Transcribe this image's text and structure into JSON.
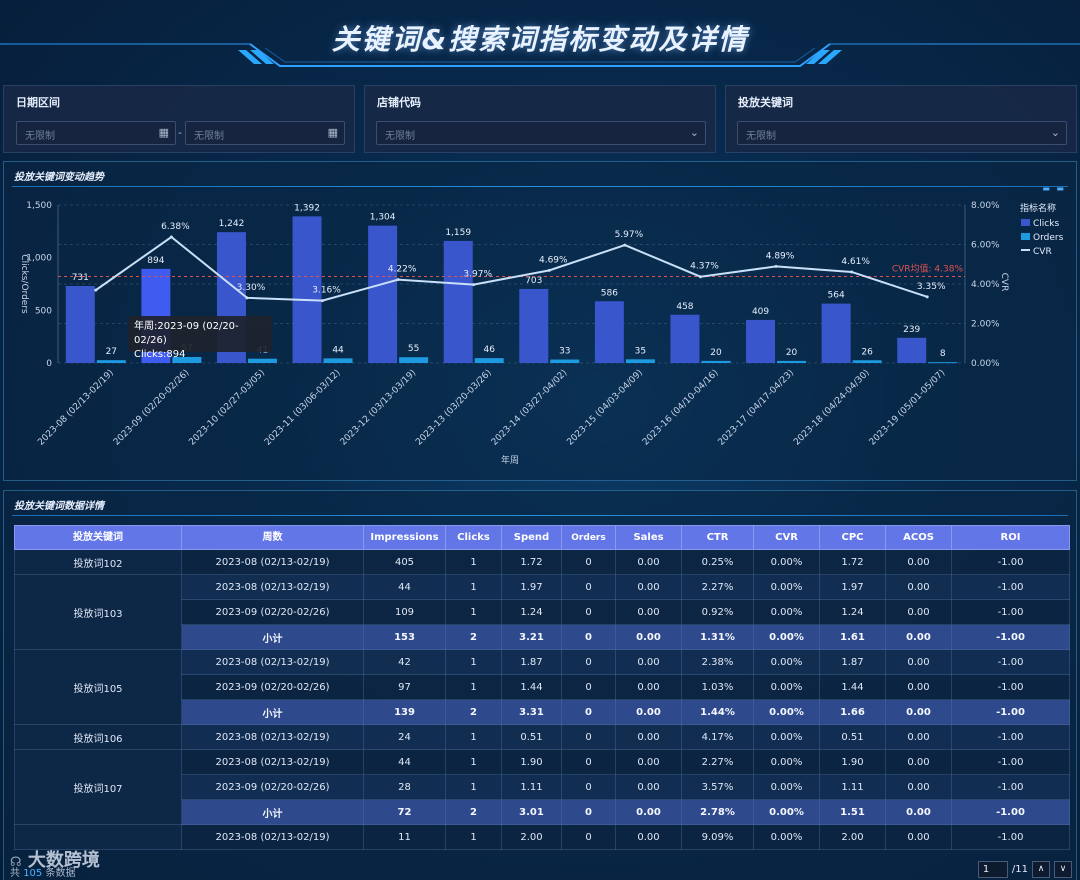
{
  "header": {
    "title": "关键词&搜索词指标变动及详情"
  },
  "filters": {
    "date": {
      "label": "日期区间",
      "start_placeholder": "无限制",
      "end_placeholder": "无限制",
      "separator": "-"
    },
    "shop": {
      "label": "店铺代码",
      "placeholder": "无限制"
    },
    "keyword": {
      "label": "投放关键词",
      "placeholder": "无限制"
    }
  },
  "chart_panel": {
    "title": "投放关键词变动趋势"
  },
  "chart_data": {
    "type": "bar",
    "categories": [
      "2023-08 (02/13-02/19)",
      "2023-09 (02/20-02/26)",
      "2023-10 (02/27-03/05)",
      "2023-11 (03/06-03/12)",
      "2023-12 (03/13-03/19)",
      "2023-13 (03/20-03/26)",
      "2023-14 (03/27-04/02)",
      "2023-15 (04/03-04/09)",
      "2023-16 (04/10-04/16)",
      "2023-17 (04/17-04/23)",
      "2023-18 (04/24-04/30)",
      "2023-19 (05/01-05/07)"
    ],
    "series": [
      {
        "name": "Clicks",
        "type": "bar",
        "axis": "left",
        "color": "#3a56cc",
        "values": [
          731,
          894,
          1242,
          1392,
          1304,
          1159,
          703,
          586,
          458,
          409,
          564,
          239
        ]
      },
      {
        "name": "Orders",
        "type": "bar",
        "axis": "left",
        "color": "#1e9be0",
        "values": [
          27,
          57,
          41,
          44,
          55,
          46,
          33,
          35,
          20,
          20,
          26,
          8
        ]
      },
      {
        "name": "CVR",
        "type": "line",
        "axis": "right",
        "color": "#c8e0f8",
        "values": [
          3.69,
          6.38,
          3.3,
          3.16,
          4.22,
          3.97,
          4.69,
          5.97,
          4.37,
          4.89,
          4.61,
          3.35
        ]
      }
    ],
    "value_labels_orders": [
      "27",
      "57",
      "41",
      "44",
      "55",
      "46",
      "33",
      "35",
      "20",
      "20",
      "26",
      "8"
    ],
    "value_labels_clicks": [
      "731",
      "894",
      "1,242",
      "1,392",
      "1,304",
      "1,159",
      "703",
      "586",
      "458",
      "409",
      "564",
      "239"
    ],
    "value_labels_cvr": [
      "",
      "6.38%",
      "3.30%",
      "3.16%",
      "4.22%",
      "3.97%",
      "4.69%",
      "5.97%",
      "4.37%",
      "4.89%",
      "4.61%",
      "3.35%"
    ],
    "xlabel": "年周",
    "ylabel": "Clicks/Orders",
    "ylabel_right": "CVR",
    "ylim": [
      0,
      1500
    ],
    "yticks": [
      "0",
      "500",
      "1,000",
      "1,500"
    ],
    "ylim_right": [
      0,
      8
    ],
    "yticks_right": [
      "0.00%",
      "2.00%",
      "4.00%",
      "6.00%",
      "8.00%"
    ],
    "average_line": {
      "label": "CVR均值: 4.38%",
      "value": 4.38,
      "color": "#e05050"
    },
    "legend_title": "指标名称",
    "legend_position": "right",
    "tooltip": {
      "line1": "年周:2023-09 (02/20-02/26)",
      "line2": "Clicks:894"
    }
  },
  "table_panel": {
    "title": "投放关键词数据详情"
  },
  "table": {
    "columns": [
      "投放关键词",
      "周数",
      "Impressions",
      "Clicks",
      "Spend",
      "Orders",
      "Sales",
      "CTR",
      "CVR",
      "CPC",
      "ACOS",
      "ROI"
    ],
    "rows": [
      {
        "kw": "投放词102",
        "span": 1,
        "type": "a",
        "cells": [
          "2023-08 (02/13-02/19)",
          "405",
          "1",
          "1.72",
          "0",
          "0.00",
          "0.25%",
          "0.00%",
          "1.72",
          "0.00",
          "-1.00"
        ]
      },
      {
        "kw": "投放词103",
        "span": 3,
        "type": "b",
        "cells": [
          "2023-08 (02/13-02/19)",
          "44",
          "1",
          "1.97",
          "0",
          "0.00",
          "2.27%",
          "0.00%",
          "1.97",
          "0.00",
          "-1.00"
        ]
      },
      {
        "kw": null,
        "type": "a",
        "cells": [
          "2023-09 (02/20-02/26)",
          "109",
          "1",
          "1.24",
          "0",
          "0.00",
          "0.92%",
          "0.00%",
          "1.24",
          "0.00",
          "-1.00"
        ]
      },
      {
        "kw": null,
        "type": "sub",
        "cells": [
          "小计",
          "153",
          "2",
          "3.21",
          "0",
          "0.00",
          "1.31%",
          "0.00%",
          "1.61",
          "0.00",
          "-1.00"
        ]
      },
      {
        "kw": "投放词105",
        "span": 3,
        "type": "b",
        "cells": [
          "2023-08 (02/13-02/19)",
          "42",
          "1",
          "1.87",
          "0",
          "0.00",
          "2.38%",
          "0.00%",
          "1.87",
          "0.00",
          "-1.00"
        ]
      },
      {
        "kw": null,
        "type": "a",
        "cells": [
          "2023-09 (02/20-02/26)",
          "97",
          "1",
          "1.44",
          "0",
          "0.00",
          "1.03%",
          "0.00%",
          "1.44",
          "0.00",
          "-1.00"
        ]
      },
      {
        "kw": null,
        "type": "sub",
        "cells": [
          "小计",
          "139",
          "2",
          "3.31",
          "0",
          "0.00",
          "1.44%",
          "0.00%",
          "1.66",
          "0.00",
          "-1.00"
        ]
      },
      {
        "kw": "投放词106",
        "span": 1,
        "type": "b",
        "cells": [
          "2023-08 (02/13-02/19)",
          "24",
          "1",
          "0.51",
          "0",
          "0.00",
          "4.17%",
          "0.00%",
          "0.51",
          "0.00",
          "-1.00"
        ]
      },
      {
        "kw": "投放词107",
        "span": 3,
        "type": "a",
        "cells": [
          "2023-08 (02/13-02/19)",
          "44",
          "1",
          "1.90",
          "0",
          "0.00",
          "2.27%",
          "0.00%",
          "1.90",
          "0.00",
          "-1.00"
        ]
      },
      {
        "kw": null,
        "type": "b",
        "cells": [
          "2023-09 (02/20-02/26)",
          "28",
          "1",
          "1.11",
          "0",
          "0.00",
          "3.57%",
          "0.00%",
          "1.11",
          "0.00",
          "-1.00"
        ]
      },
      {
        "kw": null,
        "type": "sub",
        "cells": [
          "小计",
          "72",
          "2",
          "3.01",
          "0",
          "0.00",
          "2.78%",
          "0.00%",
          "1.51",
          "0.00",
          "-1.00"
        ]
      },
      {
        "kw": "",
        "span": 1,
        "type": "a",
        "cells": [
          "2023-08 (02/13-02/19)",
          "11",
          "1",
          "2.00",
          "0",
          "0.00",
          "9.09%",
          "0.00%",
          "2.00",
          "0.00",
          "-1.00"
        ]
      }
    ]
  },
  "footer": {
    "watermark": "大数跨境",
    "total_prefix": "共",
    "total_count": "105",
    "total_suffix": "条数据",
    "page_current": "1",
    "page_total": "/11"
  }
}
